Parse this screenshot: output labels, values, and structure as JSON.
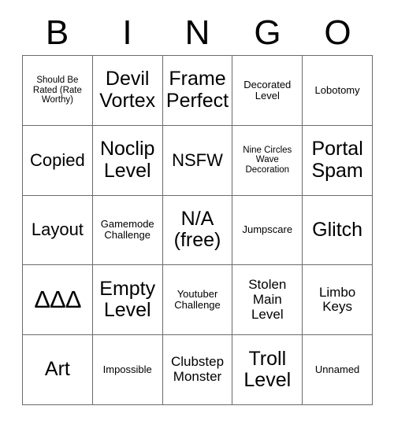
{
  "card": {
    "title": "BINGO",
    "header_letters": [
      "B",
      "I",
      "N",
      "G",
      "O"
    ],
    "rows": [
      [
        {
          "text": "Should Be Rated (Rate Worthy)",
          "size": "xs"
        },
        {
          "text": "Devil Vortex",
          "size": "xl"
        },
        {
          "text": "Frame Perfect",
          "size": "xl"
        },
        {
          "text": "Decorated Level",
          "size": "sm"
        },
        {
          "text": "Lobotomy",
          "size": "sm"
        }
      ],
      [
        {
          "text": "Copied",
          "size": "lg"
        },
        {
          "text": "Noclip Level",
          "size": "xl"
        },
        {
          "text": "NSFW",
          "size": "lg"
        },
        {
          "text": "Nine Circles Wave Decoration",
          "size": "xs"
        },
        {
          "text": "Portal Spam",
          "size": "xl"
        }
      ],
      [
        {
          "text": "Layout",
          "size": "lg"
        },
        {
          "text": "Gamemode Challenge",
          "size": "sm"
        },
        {
          "text": "N/A (free)",
          "size": "xl"
        },
        {
          "text": "Jumpscare",
          "size": "sm"
        },
        {
          "text": "Glitch",
          "size": "xl"
        }
      ],
      [
        {
          "text": "ΔΔΔ",
          "size": "delta"
        },
        {
          "text": "Empty Level",
          "size": "xl"
        },
        {
          "text": "Youtuber Challenge",
          "size": "sm"
        },
        {
          "text": "Stolen Main Level",
          "size": "md"
        },
        {
          "text": "Limbo Keys",
          "size": "md"
        }
      ],
      [
        {
          "text": "Art",
          "size": "xl"
        },
        {
          "text": "Impossible",
          "size": "sm"
        },
        {
          "text": "Clubstep Monster",
          "size": "md"
        },
        {
          "text": "Troll Level",
          "size": "xl"
        },
        {
          "text": "Unnamed",
          "size": "sm"
        }
      ]
    ],
    "colors": {
      "background": "#ffffff",
      "text": "#000000",
      "grid_line": "#6b6b6b"
    }
  }
}
